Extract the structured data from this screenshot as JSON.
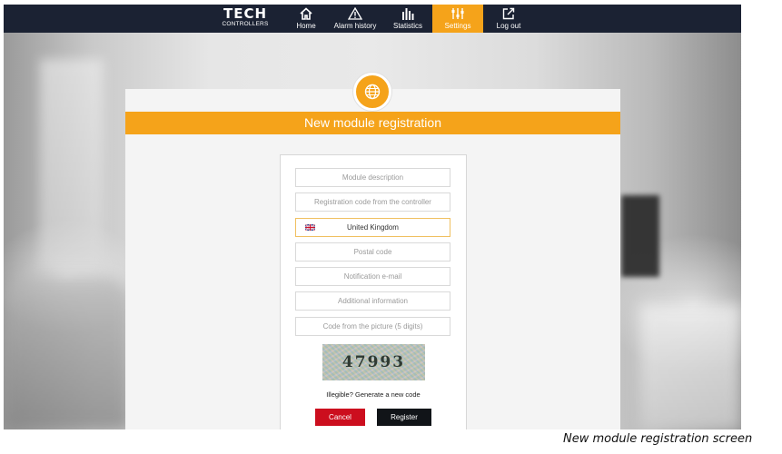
{
  "brand": {
    "name": "TECH",
    "sub": "CONTROLLERS"
  },
  "nav": [
    {
      "label": "Home",
      "icon": "home-icon"
    },
    {
      "label": "Alarm history",
      "icon": "warning-icon"
    },
    {
      "label": "Statistics",
      "icon": "bar-chart-icon"
    },
    {
      "label": "Settings",
      "icon": "sliders-icon",
      "active": true
    },
    {
      "label": "Log out",
      "icon": "logout-icon"
    }
  ],
  "form": {
    "title": "New module registration",
    "icon": "globe-icon",
    "fields": [
      {
        "placeholder": "Module description"
      },
      {
        "placeholder": "Registration code from the controller"
      },
      {
        "value": "United Kingdom",
        "type": "select",
        "flag": "uk-flag-icon"
      },
      {
        "placeholder": "Postal code"
      },
      {
        "placeholder": "Notification e-mail"
      },
      {
        "placeholder": "Additional information"
      },
      {
        "placeholder": "Code from the picture (5 digits)"
      }
    ],
    "captcha_text": "47993",
    "regenerate_label": "Illegible? Generate a new code",
    "cancel_label": "Cancel",
    "register_label": "Register"
  },
  "caption": "New module registration screen",
  "colors": {
    "accent": "#f5a31a",
    "topbar": "#1b2233",
    "cancel": "#cc0e1e",
    "register": "#111418"
  }
}
